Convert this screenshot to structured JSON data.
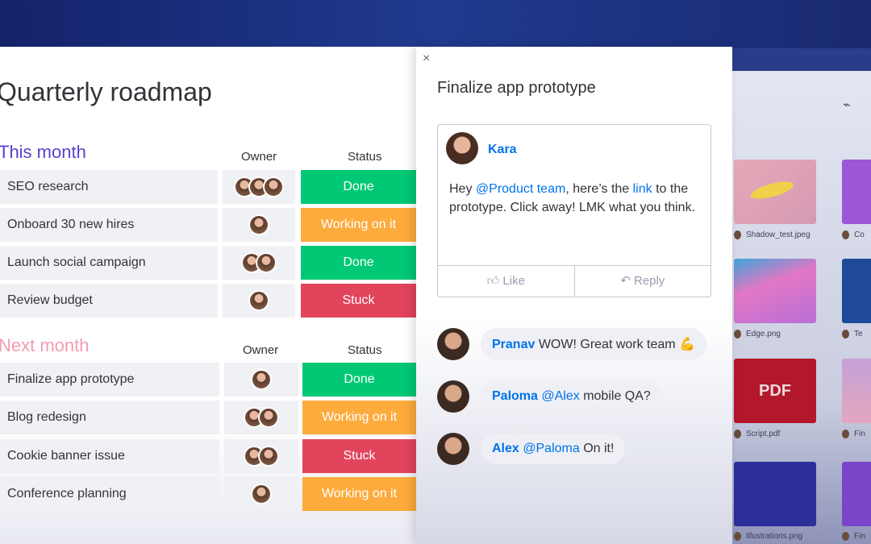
{
  "board": {
    "title": "Quarterly roadmap",
    "groups": [
      {
        "name": "This month",
        "color": "#5b3fd1",
        "owner_header": "Owner",
        "status_header": "Status",
        "rows": [
          {
            "task": "SEO research",
            "status": "Done",
            "owners": 3
          },
          {
            "task": "Onboard 30 new hires",
            "status": "Working on it",
            "owners": 1
          },
          {
            "task": "Launch social campaign",
            "status": "Done",
            "owners": 2
          },
          {
            "task": "Review budget",
            "status": "Stuck",
            "owners": 1
          }
        ]
      },
      {
        "name": "Next month",
        "color": "#f29bb1",
        "owner_header": "Owner",
        "status_header": "Status",
        "rows": [
          {
            "task": "Finalize app prototype",
            "status": "Done",
            "owners": 1
          },
          {
            "task": "Blog redesign",
            "status": "Working on it",
            "owners": 2
          },
          {
            "task": "Cookie banner issue",
            "status": "Stuck",
            "owners": 2
          },
          {
            "task": "Conference planning",
            "status": "Working on it",
            "owners": 1
          }
        ]
      }
    ]
  },
  "status_colors": {
    "Done": "#00c875",
    "Working on it": "#fdab3d",
    "Stuck": "#e2445c"
  },
  "panel": {
    "close": "×",
    "title": "Finalize app prototype",
    "post": {
      "author": "Kara",
      "text_1": "Hey ",
      "mention": "@Product team",
      "text_2": ", here’s the ",
      "link": "link",
      "text_3": " to the prototype. Click away! LMK what you think.",
      "like": "Like",
      "reply": "Reply"
    },
    "replies": [
      {
        "author": "Pranav",
        "mention": "",
        "text": "WOW! Great work team 💪"
      },
      {
        "author": "Paloma",
        "mention": "@Alex",
        "text": "mobile QA?"
      },
      {
        "author": "Alex",
        "mention": "@Paloma",
        "text": "On it!"
      }
    ]
  },
  "files": {
    "items": [
      "Shadow_test.jpeg",
      "Co",
      "Edge.png",
      "Te",
      "Script.pdf",
      "Fin",
      "Illustrations.png",
      "Fin"
    ],
    "pdf_label": "PDF"
  }
}
